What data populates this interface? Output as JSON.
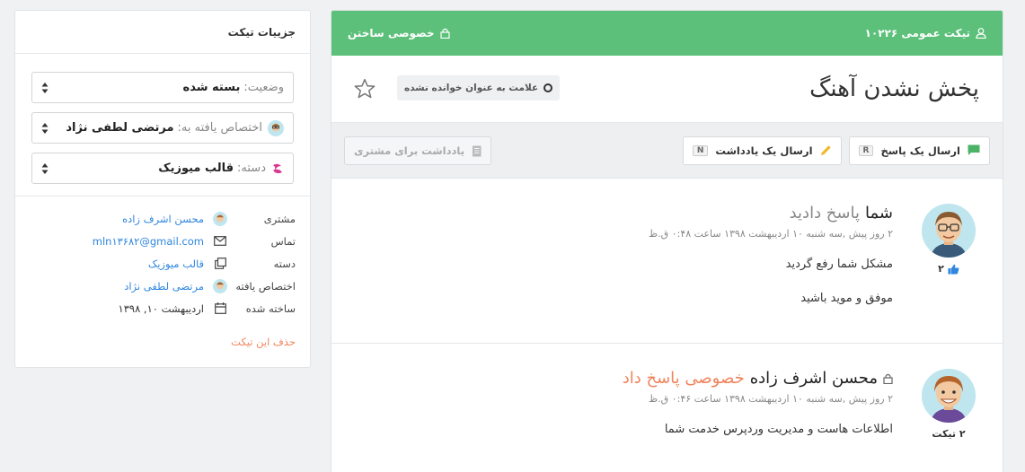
{
  "sidebar": {
    "title": "جزییات تیکت",
    "status_label": "وضعیت:",
    "status_value": "بسته شده",
    "assigned_label": "اختصاص یافته به:",
    "assigned_value": "مرتضی لطفی نژاد",
    "category_label": "دسته:",
    "category_value": "قالب میوزیک",
    "meta": {
      "customer_key": "مشتری",
      "customer_value": "محسن اشرف زاده",
      "contact_key": "تماس",
      "contact_value": "mln۱۳۶۸۲@gmail.com",
      "category_key": "دسته",
      "category_value": "قالب میوزیک",
      "assigned_key": "اختصاص یافته",
      "assigned_value": "مرتضی لطفی نژاد",
      "created_key": "ساخته شده",
      "created_value": "اردیبهشت ۱۰, ۱۳۹۸"
    },
    "delete_label": "حذف این تیکت"
  },
  "header": {
    "ticket_label": "تیکت عمومی ۱۰۲۲۶",
    "make_private": "خصوصی ساختن"
  },
  "ticket": {
    "title": "پخش نشدن آهنگ",
    "mark_unread": "علامت به عنوان خوانده نشده"
  },
  "toolbar": {
    "reply_label": "ارسال یک پاسخ",
    "reply_key": "R",
    "note_label": "ارسال یک یادداشت",
    "note_key": "N",
    "customer_note_label": "یادداشت برای مشتری"
  },
  "messages": [
    {
      "author": "شما",
      "action": "پاسخ دادید",
      "time": "۲ روز پیش ,سه شنبه ۱۰ اردیبهشت ۱۳۹۸ ساعت ۰:۴۸ ق.ظ",
      "lines": [
        "مشکل شما رفع گردید",
        "موفق و موید باشید"
      ],
      "likes": "۲"
    },
    {
      "author": "محسن اشرف زاده",
      "action": "خصوصی پاسخ داد",
      "time": "۲ روز پیش ,سه شنبه ۱۰ اردیبهشت ۱۳۹۸ ساعت ۰:۴۶ ق.ظ",
      "lines": [
        "اطلاعات هاست و مدیریت وردپرس خدمت شما"
      ],
      "tickets": "۲ تیکت"
    }
  ],
  "colors": {
    "green_bar": "#5cc07a",
    "link": "#2e86de",
    "orange": "#f0845c"
  }
}
